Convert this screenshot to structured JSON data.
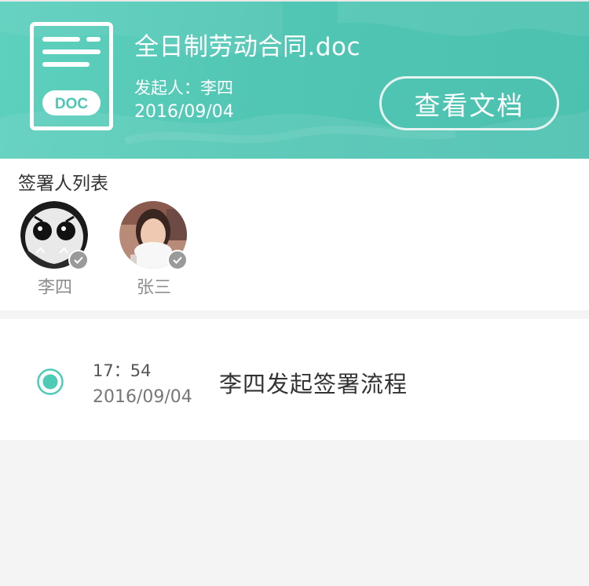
{
  "document": {
    "title": "全日制劳动合同.doc",
    "initiator_line": "发起人：李四",
    "date": "2016/09/04",
    "icon_label": "DOC",
    "view_button_label": "查看文档"
  },
  "signers": {
    "heading": "签署人列表",
    "items": [
      {
        "name": "李四",
        "signed": true
      },
      {
        "name": "张三",
        "signed": true
      }
    ]
  },
  "timeline": {
    "items": [
      {
        "time": "17：54",
        "date": "2016/09/04",
        "event": "李四发起签署流程"
      }
    ]
  },
  "colors": {
    "header_teal": "#52c6b4",
    "accent_teal": "#4ecbb7",
    "badge_gray": "#9a9a9a",
    "background": "#f4f4f4"
  }
}
